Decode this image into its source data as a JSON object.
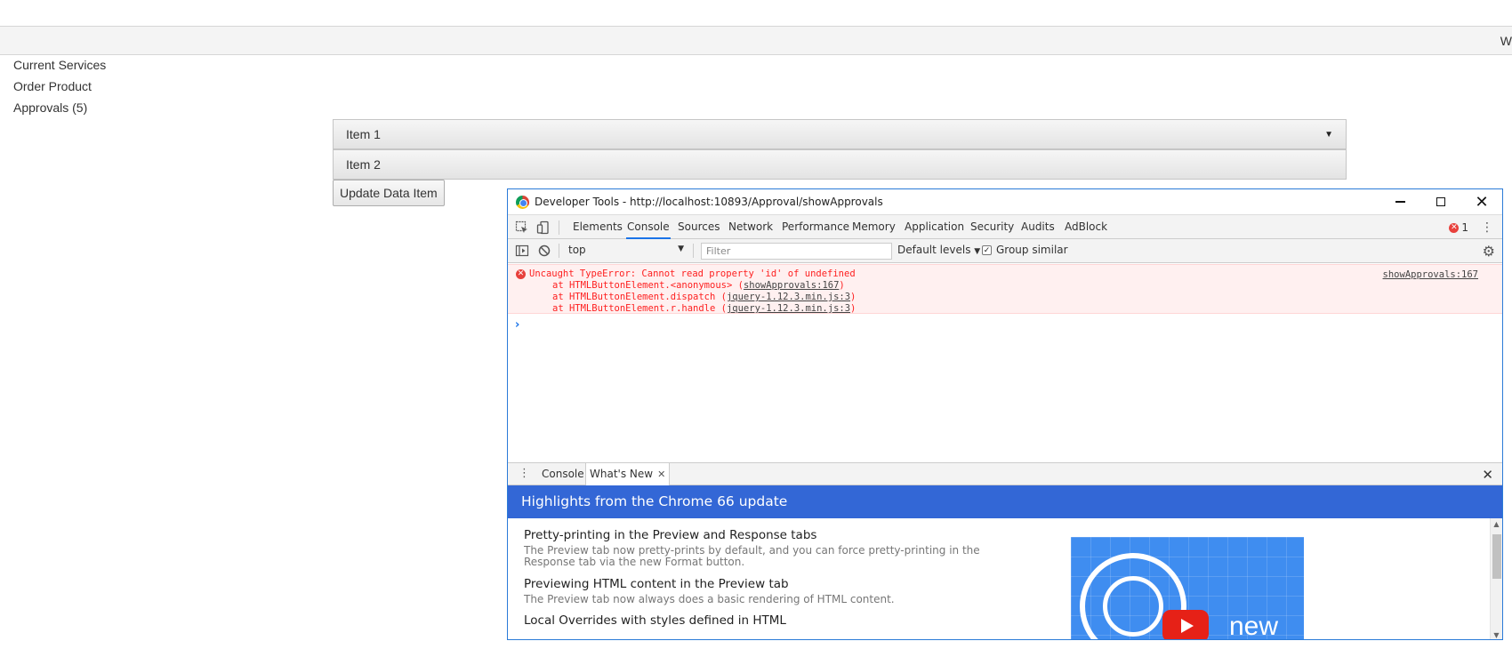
{
  "page": {
    "topbar_text": "W",
    "nav": [
      "Current Services",
      "Order Product",
      "Approvals (5)"
    ],
    "accordion": [
      {
        "label": "Item 1",
        "arrow": "▼"
      },
      {
        "label": "Item 2"
      }
    ],
    "update_button": "Update Data Item"
  },
  "devtools": {
    "window_title": "Developer Tools - http://localhost:10893/Approval/showApprovals",
    "window_controls": {
      "minimize": "",
      "maximize": "",
      "close": "✕"
    },
    "tabs": [
      "Elements",
      "Console",
      "Sources",
      "Network",
      "Performance",
      "Memory",
      "Application",
      "Security",
      "Audits",
      "AdBlock"
    ],
    "active_tab": "Console",
    "error_count": "1",
    "toolbar": {
      "context": "top",
      "filter_placeholder": "Filter",
      "levels": "Default levels",
      "group_similar": "Group similar"
    },
    "error": {
      "message": "Uncaught TypeError: Cannot read property 'id' of undefined",
      "source": "showApprovals:167",
      "stack": [
        {
          "prefix": "at HTMLButtonElement.<anonymous> (",
          "link": "showApprovals:167",
          "suffix": ")"
        },
        {
          "prefix": "at HTMLButtonElement.dispatch (",
          "link": "jquery-1.12.3.min.js:3",
          "suffix": ")"
        },
        {
          "prefix": "at HTMLButtonElement.r.handle (",
          "link": "jquery-1.12.3.min.js:3",
          "suffix": ")"
        }
      ]
    },
    "prompt": "›",
    "drawer": {
      "tabs": [
        "Console",
        "What's New"
      ],
      "active_tab": "What's New",
      "banner": "Highlights from the Chrome 66 update",
      "features": [
        {
          "title": "Pretty-printing in the Preview and Response tabs",
          "desc": "The Preview tab now pretty-prints by default, and you can force pretty-printing in the Response tab via the new Format button."
        },
        {
          "title": "Previewing HTML content in the Preview tab",
          "desc": "The Preview tab now always does a basic rendering of HTML content."
        },
        {
          "title": "Local Overrides with styles defined in HTML",
          "desc": ""
        }
      ],
      "video_text": "new"
    }
  },
  "colors": {
    "devtools_border": "#2b7bd8",
    "banner": "#3367d6",
    "error_text": "#fe2020",
    "error_bg": "#fff0f0",
    "active_tab_underline": "#1a73e8"
  }
}
